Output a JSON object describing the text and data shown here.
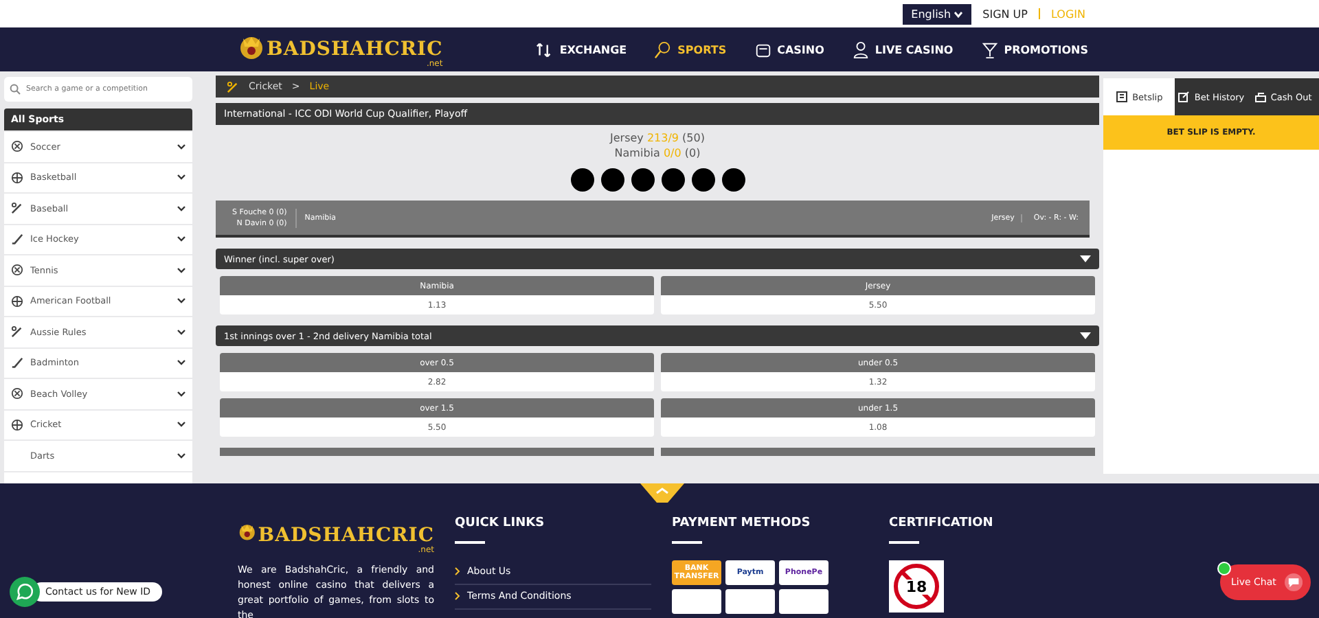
{
  "top_bar": {
    "language": "English",
    "links": [
      {
        "label": "SIGN UP",
        "kind": "plain"
      },
      {
        "label": "LOGIN",
        "kind": "accent"
      }
    ]
  },
  "header": {
    "logo": {
      "name": "BADSHAHCRIC",
      "suffix": ".net"
    },
    "nav": [
      {
        "label": "EXCHANGE",
        "selected": false
      },
      {
        "label": "SPORTS",
        "selected": true
      },
      {
        "label": "CASINO",
        "selected": false
      },
      {
        "label": "LIVE CASINO",
        "selected": false
      },
      {
        "label": "PROMOTIONS",
        "selected": false
      }
    ]
  },
  "sidebar": {
    "search": {
      "placeholder": "Search a game or a competition"
    },
    "heading": "All Sports",
    "items": [
      {
        "label": "Soccer",
        "has_icon": true
      },
      {
        "label": "Basketball",
        "has_icon": true
      },
      {
        "label": "Baseball",
        "has_icon": true
      },
      {
        "label": "Ice Hockey",
        "has_icon": true
      },
      {
        "label": "Tennis",
        "has_icon": true
      },
      {
        "label": "American Football",
        "has_icon": true
      },
      {
        "label": "Aussie Rules",
        "has_icon": true
      },
      {
        "label": "Badminton",
        "has_icon": true
      },
      {
        "label": "Beach Volley",
        "has_icon": true
      },
      {
        "label": "Cricket",
        "has_icon": true
      },
      {
        "label": "Darts",
        "has_icon": false
      }
    ]
  },
  "match": {
    "breadcrumb": [
      "Cricket",
      ">",
      "Live"
    ],
    "competition": "International - ICC ODI World Cup Qualifier, Playoff",
    "scores": [
      {
        "team": "Jersey",
        "score": "213/9",
        "overs": "(50)"
      },
      {
        "team": "Namibia",
        "score": "0/0",
        "overs": "(0)"
      }
    ],
    "scoreboard": {
      "batsmen": [
        "S Fouche 0 (0)",
        "N Davin 0 (0)"
      ],
      "batting_team": "Namibia",
      "other_team": "Jersey",
      "stats": "Ov: - R: - W:"
    },
    "markets": [
      {
        "title": "Winner (incl. super over)",
        "expanded": true,
        "rows": [
          [
            {
              "label": "Namibia",
              "odds": "1.13"
            },
            {
              "label": "Jersey",
              "odds": "5.50"
            }
          ]
        ]
      },
      {
        "title": "1st innings over 1 - 2nd delivery Namibia total",
        "expanded": true,
        "rows": [
          [
            {
              "label": "over 0.5",
              "odds": "2.82"
            },
            {
              "label": "under 0.5",
              "odds": "1.32"
            }
          ],
          [
            {
              "label": "over 1.5",
              "odds": "5.50"
            },
            {
              "label": "under 1.5",
              "odds": "1.08"
            }
          ]
        ]
      }
    ]
  },
  "betslip": {
    "tabs": [
      {
        "label": "Betslip",
        "selected": true
      },
      {
        "label": "Bet History",
        "selected": false
      },
      {
        "label": "Cash Out",
        "selected": false
      }
    ],
    "message": "BET SLIP IS EMPTY."
  },
  "footer": {
    "logo": {
      "name": "BADSHAHCRIC",
      "suffix": ".net"
    },
    "about": "We are BadshahCric, a friendly and honest online casino that delivers a great portfolio of games, from slots to the",
    "quick_links": {
      "title": "QUICK LINKS",
      "items": [
        "About Us",
        "Terms And Conditions"
      ]
    },
    "payment": {
      "title": "PAYMENT METHODS",
      "logos": [
        "BANK TRANSFER",
        "Paytm",
        "PhonePe"
      ]
    },
    "certification": {
      "title": "CERTIFICATION",
      "badge": "18"
    }
  },
  "whatsapp": {
    "label": "Contact us for New ID"
  },
  "live_chat": {
    "label": "Live Chat",
    "online": true
  }
}
